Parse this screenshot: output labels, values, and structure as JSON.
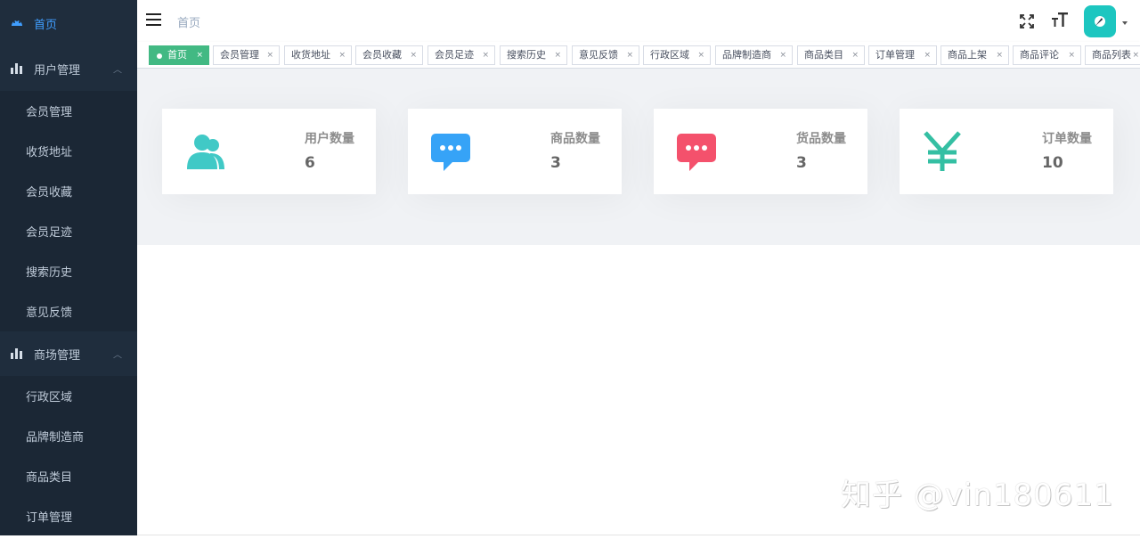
{
  "sidebar": {
    "home": {
      "label": "首页",
      "icon": "dashboard-icon"
    },
    "groups": [
      {
        "label": "用户管理",
        "icon": "bar-chart-icon",
        "items": [
          "会员管理",
          "收货地址",
          "会员收藏",
          "会员足迹",
          "搜索历史",
          "意见反馈"
        ]
      },
      {
        "label": "商场管理",
        "icon": "bar-chart-icon",
        "items": [
          "行政区域",
          "品牌制造商",
          "商品类目",
          "订单管理"
        ]
      }
    ],
    "colors": {
      "background": "#1f2d3d",
      "active": "#409eff"
    }
  },
  "topbar": {
    "breadcrumb": "首页"
  },
  "tags": [
    "首页",
    "会员管理",
    "收货地址",
    "会员收藏",
    "会员足迹",
    "搜索历史",
    "意见反馈",
    "行政区域",
    "品牌制造商",
    "商品类目",
    "订单管理",
    "商品上架",
    "商品评论",
    "商品列表"
  ],
  "tags_close": "×",
  "cards": [
    {
      "title": "用户数量",
      "value": "6",
      "icon": "users-icon",
      "color": "#40c9c6"
    },
    {
      "title": "商品数量",
      "value": "3",
      "icon": "message-icon",
      "color": "#36a3f7"
    },
    {
      "title": "货品数量",
      "value": "3",
      "icon": "message-icon",
      "color": "#f4516c"
    },
    {
      "title": "订单数量",
      "value": "10",
      "icon": "yen-icon",
      "color": "#34bfa3"
    }
  ],
  "watermark": "知乎 @vin180611"
}
